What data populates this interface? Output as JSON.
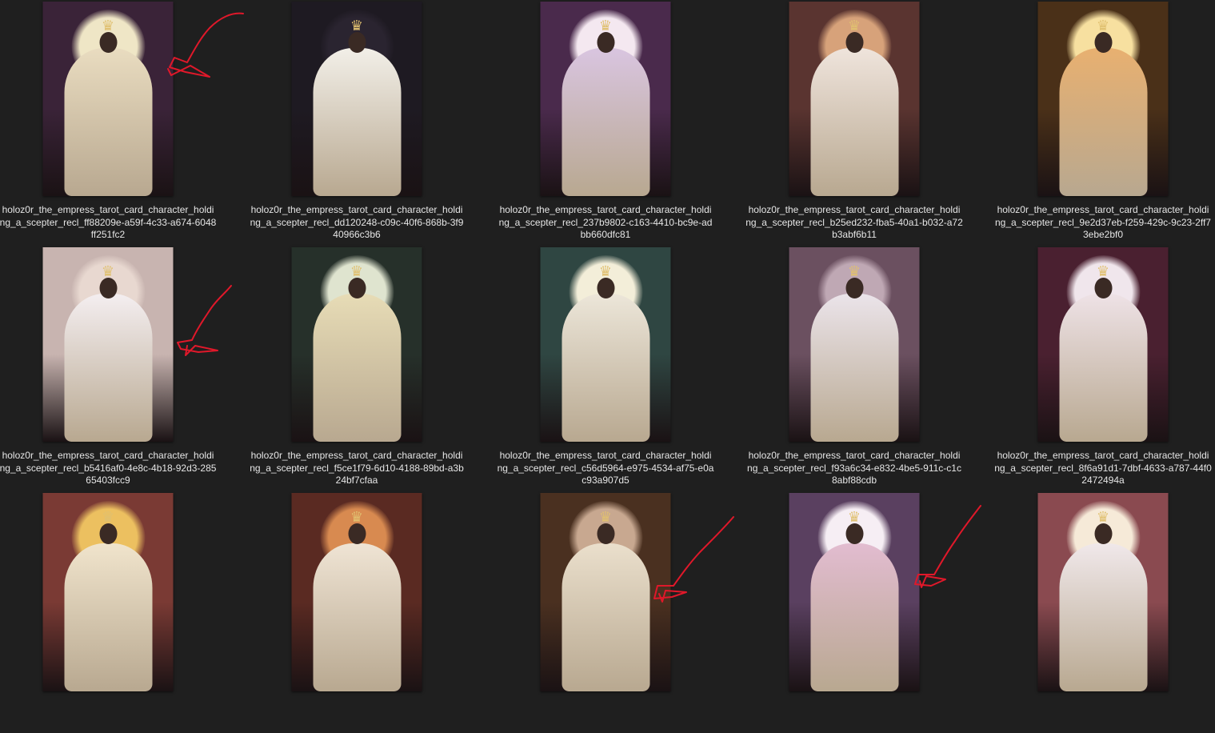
{
  "tiles": [
    {
      "caption": [
        "holoz0r_the_empress_tarot_card_character_holdi",
        "ng_a_scepter_recl_ff88209e-a59f-4c33-a674-6048",
        "ff251fc2"
      ],
      "bg": "#3a2338",
      "moon": "#efe6c6",
      "robe": "#e9dcc0"
    },
    {
      "caption": [
        "holoz0r_the_empress_tarot_card_character_holdi",
        "ng_a_scepter_recl_dd120248-c09c-40f6-868b-3f9",
        "40966c3b6"
      ],
      "bg": "#1e1a22",
      "moon": "#2a2430",
      "robe": "#f2efe8"
    },
    {
      "caption": [
        "holoz0r_the_empress_tarot_card_character_holdi",
        "ng_a_scepter_recl_237b9802-c163-4410-bc9e-ad",
        "bb660dfc81"
      ],
      "bg": "#4a2a4c",
      "moon": "#f4e8f0",
      "robe": "#d9c5e0"
    },
    {
      "caption": [
        "holoz0r_the_empress_tarot_card_character_holdi",
        "ng_a_scepter_recl_b25ed232-fba5-40a1-b032-a72",
        "b3abf6b11"
      ],
      "bg": "#5a3430",
      "moon": "#d7a27a",
      "robe": "#efe4dc"
    },
    {
      "caption": [
        "holoz0r_the_empress_tarot_card_character_holdi",
        "ng_a_scepter_recl_9e2d37eb-f259-429c-9c23-2ff7",
        "3ebe2bf0"
      ],
      "bg": "#4a3018",
      "moon": "#f7e0a0",
      "robe": "#e8b070"
    },
    {
      "caption": [
        "holoz0r_the_empress_tarot_card_character_holdi",
        "ng_a_scepter_recl_b5416af0-4e8c-4b18-92d3-285",
        "65403fcc9"
      ],
      "bg": "#c8b4b0",
      "moon": "#e8d8d0",
      "robe": "#f4eef0"
    },
    {
      "caption": [
        "holoz0r_the_empress_tarot_card_character_holdi",
        "ng_a_scepter_recl_f5ce1f79-6d10-4188-89bd-a3b",
        "24bf7cfaa"
      ],
      "bg": "#26302a",
      "moon": "#dfe4cf",
      "robe": "#e7dcb6"
    },
    {
      "caption": [
        "holoz0r_the_empress_tarot_card_character_holdi",
        "ng_a_scepter_recl_c56d5964-e975-4534-af75-e0a",
        "c93a907d5"
      ],
      "bg": "#2f4642",
      "moon": "#f3eed9",
      "robe": "#ece6d9"
    },
    {
      "caption": [
        "holoz0r_the_empress_tarot_card_character_holdi",
        "ng_a_scepter_recl_f93a6c34-e832-4be5-911c-c1c",
        "8abf88cdb"
      ],
      "bg": "#6b5060",
      "moon": "#bfa8b4",
      "robe": "#ebe4ea"
    },
    {
      "caption": [
        "holoz0r_the_empress_tarot_card_character_holdi",
        "ng_a_scepter_recl_8f6a91d1-7dbf-4633-a787-44f0",
        "2472494a"
      ],
      "bg": "#4a2030",
      "moon": "#f0e6ec",
      "robe": "#eee2e6"
    },
    {
      "caption": [],
      "bg": "#7a3a34",
      "moon": "#ecc060",
      "robe": "#f0e4cc"
    },
    {
      "caption": [],
      "bg": "#5a2a22",
      "moon": "#d88a50",
      "robe": "#efe4d4"
    },
    {
      "caption": [],
      "bg": "#4a3020",
      "moon": "#c8a890",
      "robe": "#eadfcc"
    },
    {
      "caption": [],
      "bg": "#5a4060",
      "moon": "#f6eef4",
      "robe": "#e2bcd0"
    },
    {
      "caption": [],
      "bg": "#8a4a50",
      "moon": "#f6ead8",
      "robe": "#f0e8ea"
    }
  ],
  "annotation_color": "#e0182a",
  "icons": {
    "crown": "crown-icon"
  }
}
